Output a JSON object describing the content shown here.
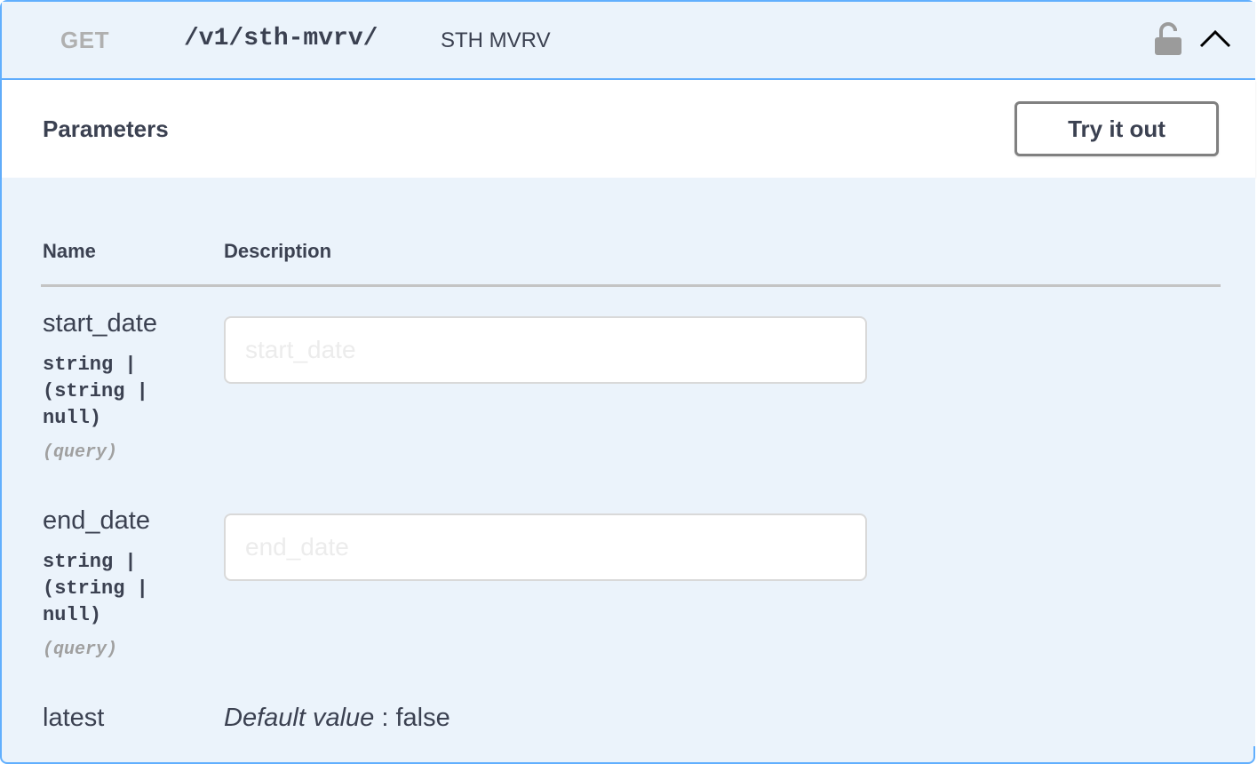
{
  "operation": {
    "method": "GET",
    "path": "/v1/sth-mvrv/",
    "summary": "STH MVRV",
    "icons": {
      "lock": "lock-icon",
      "collapse": "chevron-up-icon"
    },
    "colors": {
      "accent": "#61affe",
      "background": "#ebf3fb"
    }
  },
  "parameters_section": {
    "title": "Parameters",
    "try_button_label": "Try it out",
    "columns": {
      "name": "Name",
      "description": "Description"
    },
    "params": [
      {
        "name": "start_date",
        "type": "string | (string | null)",
        "in": "(query)",
        "placeholder": "start_date",
        "value": ""
      },
      {
        "name": "end_date",
        "type": "string | (string | null)",
        "in": "(query)",
        "placeholder": "end_date",
        "value": ""
      },
      {
        "name": "latest",
        "default_label": "Default value",
        "default_separator": " : ",
        "default_value": "false"
      }
    ]
  }
}
